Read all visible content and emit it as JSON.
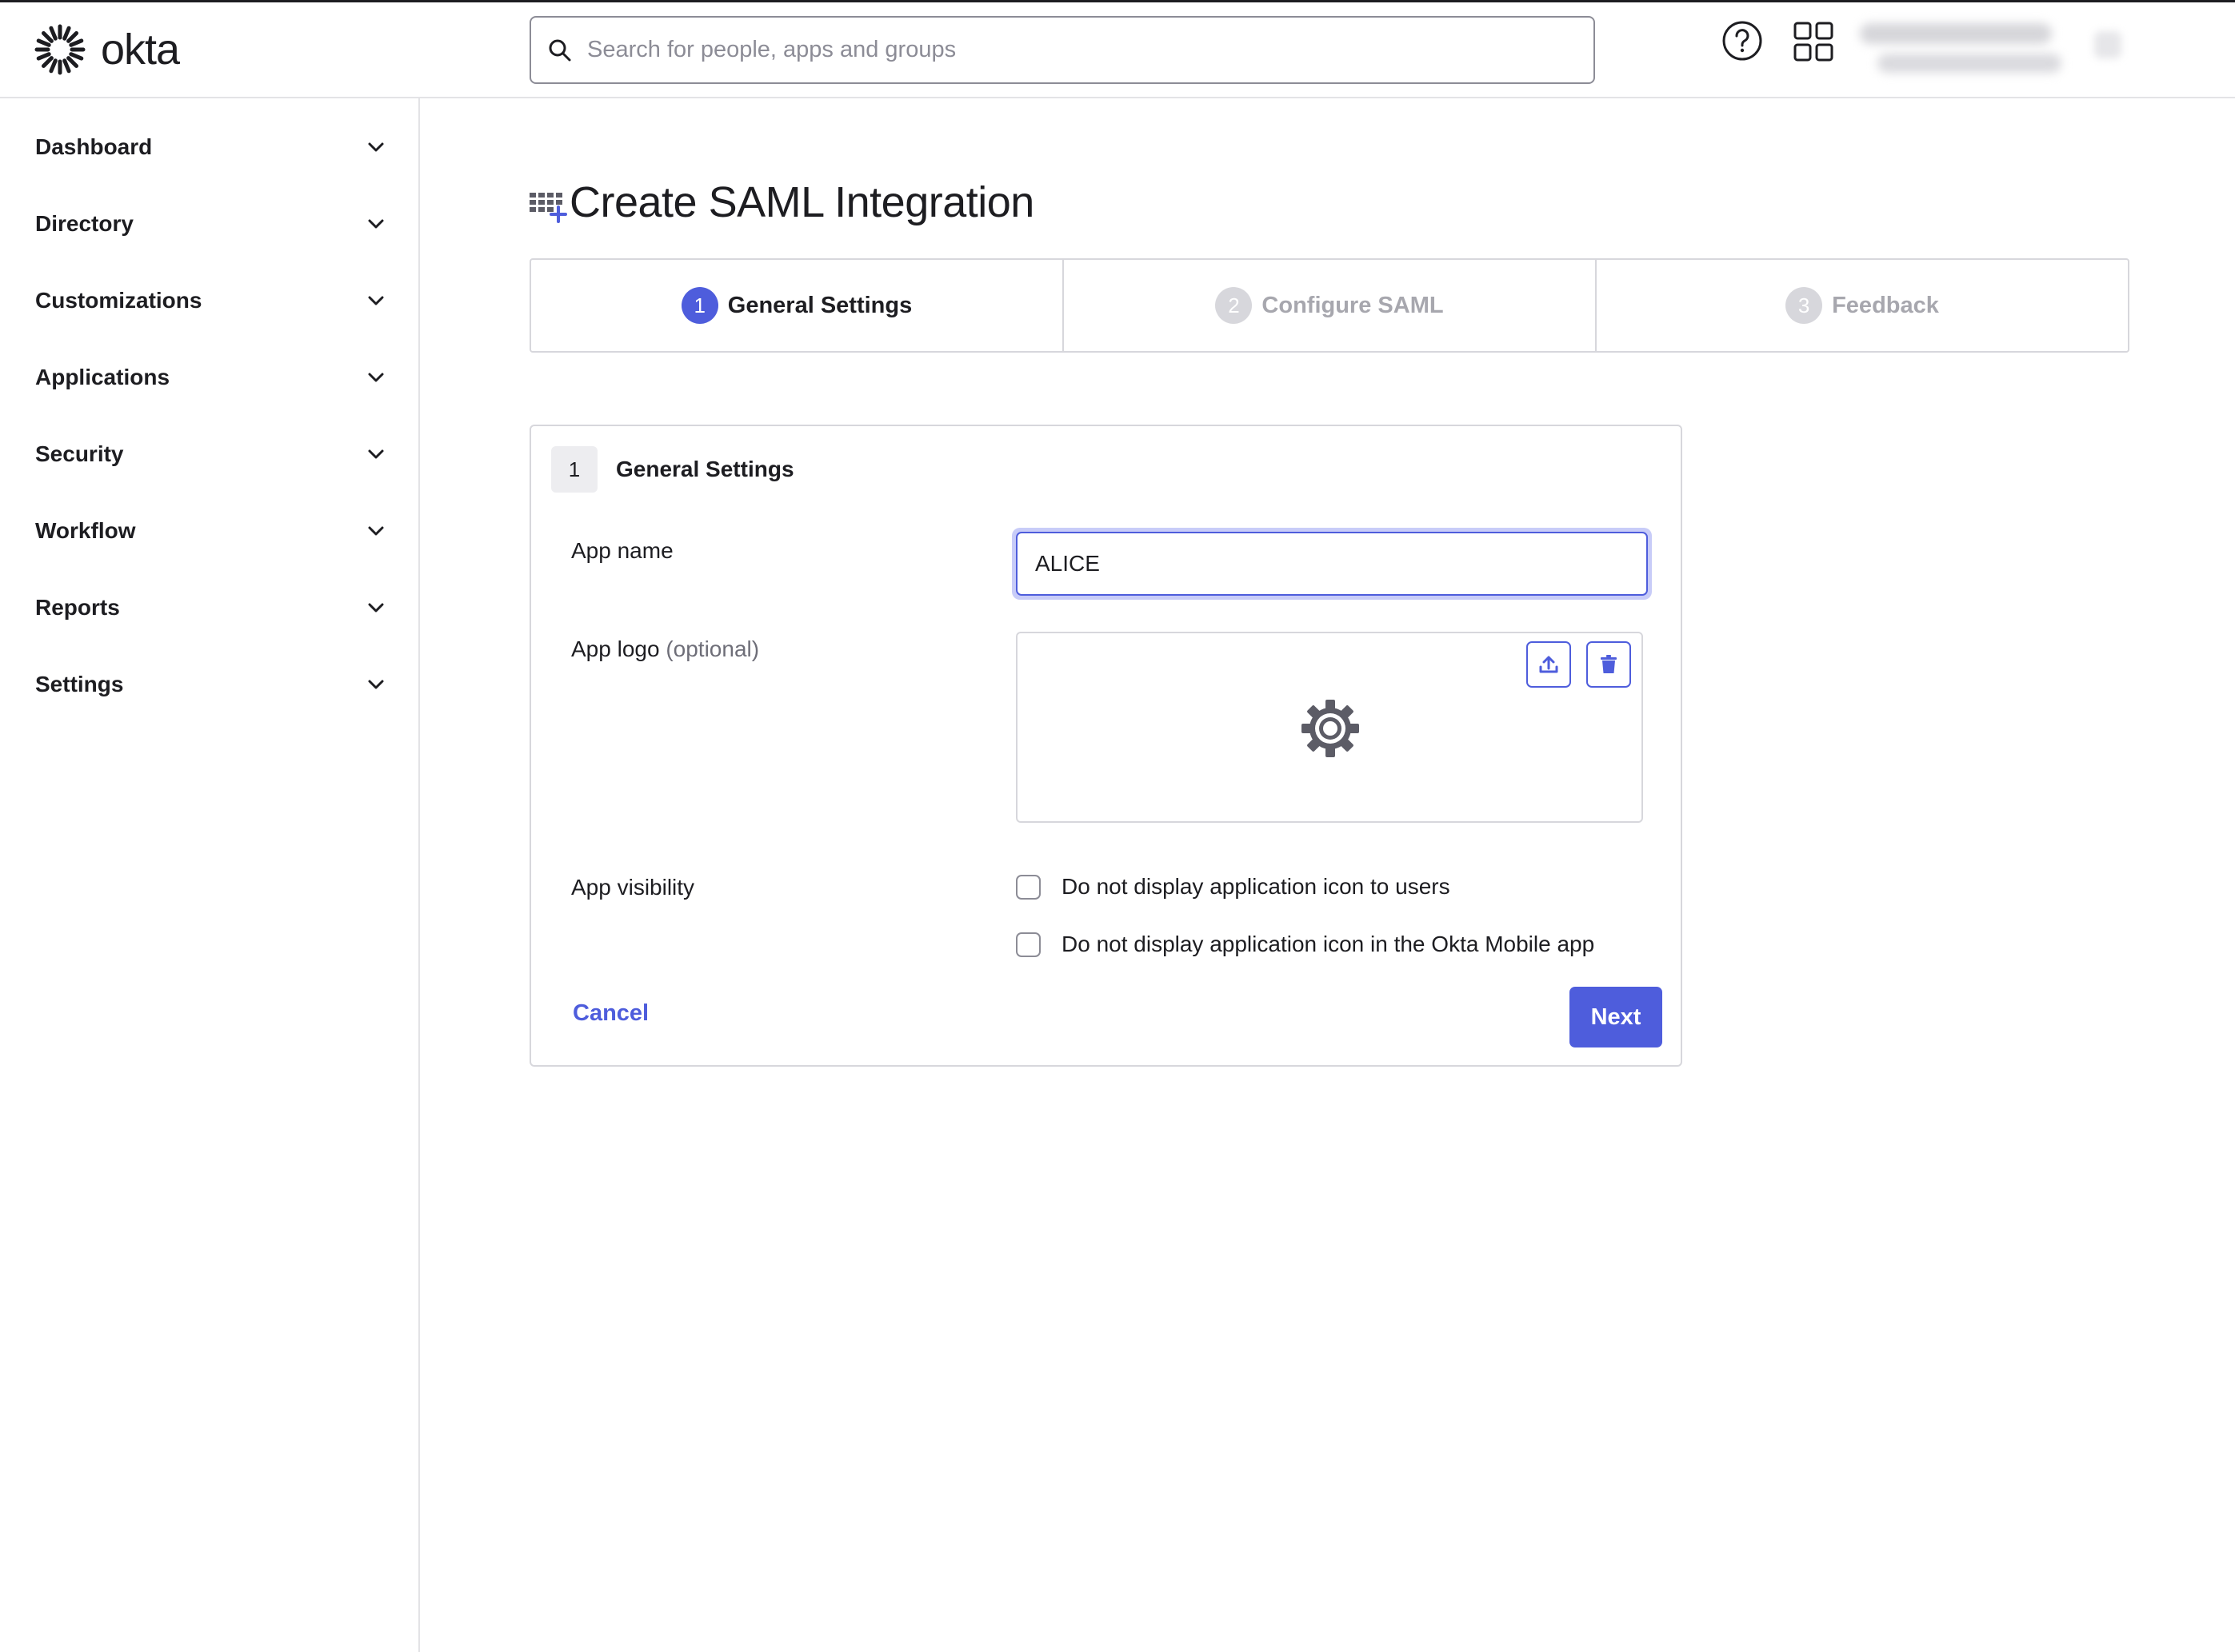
{
  "app": {
    "brand": "okta"
  },
  "colors": {
    "accent": "#4e5ddc",
    "border": "#d7d7dc",
    "text": "#1d1d21",
    "muted": "#a7a7ae"
  },
  "header": {
    "search_placeholder": "Search for people, apps and groups",
    "icons": [
      "search-icon",
      "help-icon",
      "apps-grid-icon"
    ]
  },
  "sidebar": {
    "items": [
      {
        "label": "Dashboard"
      },
      {
        "label": "Directory"
      },
      {
        "label": "Customizations"
      },
      {
        "label": "Applications"
      },
      {
        "label": "Security"
      },
      {
        "label": "Workflow"
      },
      {
        "label": "Reports"
      },
      {
        "label": "Settings"
      }
    ]
  },
  "page": {
    "title": "Create SAML Integration"
  },
  "steps": [
    {
      "num": "1",
      "label": "General Settings",
      "state": "active"
    },
    {
      "num": "2",
      "label": "Configure SAML",
      "state": "inactive"
    },
    {
      "num": "3",
      "label": "Feedback",
      "state": "inactive"
    }
  ],
  "card": {
    "badge": "1",
    "title": "General Settings",
    "app_name_label": "App name",
    "app_name_value": "ALICE",
    "app_logo_label": "App logo",
    "app_logo_optional": "(optional)",
    "app_visibility_label": "App visibility",
    "checkbox_1": "Do not display application icon to users",
    "checkbox_2": "Do not display application icon in the Okta Mobile app",
    "cancel": "Cancel",
    "next": "Next"
  }
}
